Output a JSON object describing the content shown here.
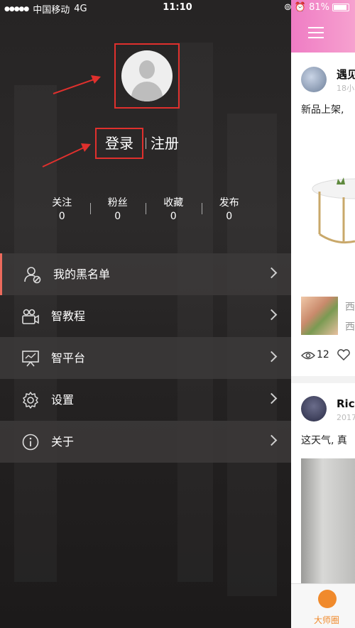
{
  "status_bar": {
    "signal_dots": "●●●●●",
    "carrier": "中国移动",
    "network": "4G",
    "time": "11:10",
    "battery": "81%",
    "battery_level": 0.81
  },
  "profile": {
    "login_label": "登录",
    "register_label": "注册"
  },
  "stats": [
    {
      "label": "关注",
      "value": "0"
    },
    {
      "label": "粉丝",
      "value": "0"
    },
    {
      "label": "收藏",
      "value": "0"
    },
    {
      "label": "发布",
      "value": "0"
    }
  ],
  "menu": [
    {
      "label": "我的黑名单",
      "icon": "user-block-icon"
    },
    {
      "label": "智教程",
      "icon": "video-camera-icon"
    },
    {
      "label": "智平台",
      "icon": "presentation-icon"
    },
    {
      "label": "设置",
      "icon": "gear-icon"
    },
    {
      "label": "关于",
      "icon": "info-icon"
    }
  ],
  "peek": {
    "post1": {
      "name": "遇见",
      "time": "18小",
      "text": "新品上架,",
      "tag1": "西",
      "tag2": "西",
      "views": "12"
    },
    "post2": {
      "name": "Ric",
      "time": "2017",
      "text": "这天气, 真"
    },
    "tab_label": "大师圈"
  },
  "colors": {
    "highlight_box": "#e0302d",
    "accent_pink": "#ef7cc4",
    "tab_orange": "#f08a2c"
  }
}
